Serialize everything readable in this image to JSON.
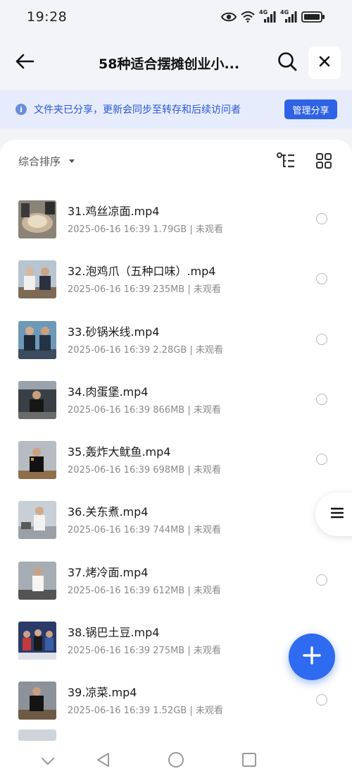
{
  "status_bar": {
    "time": "19:28",
    "icons": [
      "eye-icon",
      "wifi-icon",
      "signal-4g-icon",
      "signal-4g-icon",
      "battery-icon"
    ],
    "network_label_1": "4G",
    "network_label_2": "4G"
  },
  "header": {
    "title": "58种适合摆摊创业小...",
    "back_icon": "arrow-left-icon",
    "search_icon": "search-icon",
    "close_icon": "close-icon"
  },
  "notice": {
    "icon": "info-icon",
    "icon_glyph": "i",
    "text": "文件夹已分享，更新会同步至转存和后续访问者",
    "button_label": "管理分享"
  },
  "toolbar": {
    "sort_label": "综合排序",
    "tree_view_icon": "tree-view-icon",
    "grid_view_icon": "grid-view-icon"
  },
  "files": [
    {
      "name": "31.鸡丝凉面.mp4",
      "meta": "2025-06-16 16:39  1.79GB | 未观看"
    },
    {
      "name": "32.泡鸡爪（五种口味）.mp4",
      "meta": "2025-06-16 16:39  235MB | 未观看"
    },
    {
      "name": "33.砂锅米线.mp4",
      "meta": "2025-06-16 16:39  2.28GB | 未观看"
    },
    {
      "name": "34.肉蛋堡.mp4",
      "meta": "2025-06-16 16:39  866MB | 未观看"
    },
    {
      "name": "35.轰炸大鱿鱼.mp4",
      "meta": "2025-06-16 16:39  698MB | 未观看"
    },
    {
      "name": "36.关东煮.mp4",
      "meta": "2025-06-16 16:39  744MB | 未观看"
    },
    {
      "name": "37.烤冷面.mp4",
      "meta": "2025-06-16 16:39  612MB | 未观看"
    },
    {
      "name": "38.锅巴土豆.mp4",
      "meta": "2025-06-16 16:39  275MB | 未观看"
    },
    {
      "name": "39.凉菜.mp4",
      "meta": "2025-06-16 16:39  1.52GB | 未观看"
    }
  ],
  "floating": {
    "menu_icon": "menu-icon",
    "add_icon": "plus-icon"
  },
  "nav": {
    "icons": [
      "chevron-down-icon",
      "back-triangle-icon",
      "home-circle-icon",
      "recents-square-icon"
    ]
  },
  "colors": {
    "accent": "#2f63e6",
    "notice_bg": "#e6ecfb",
    "notice_text": "#2b57d6",
    "page_bg": "#f3f4f7"
  }
}
